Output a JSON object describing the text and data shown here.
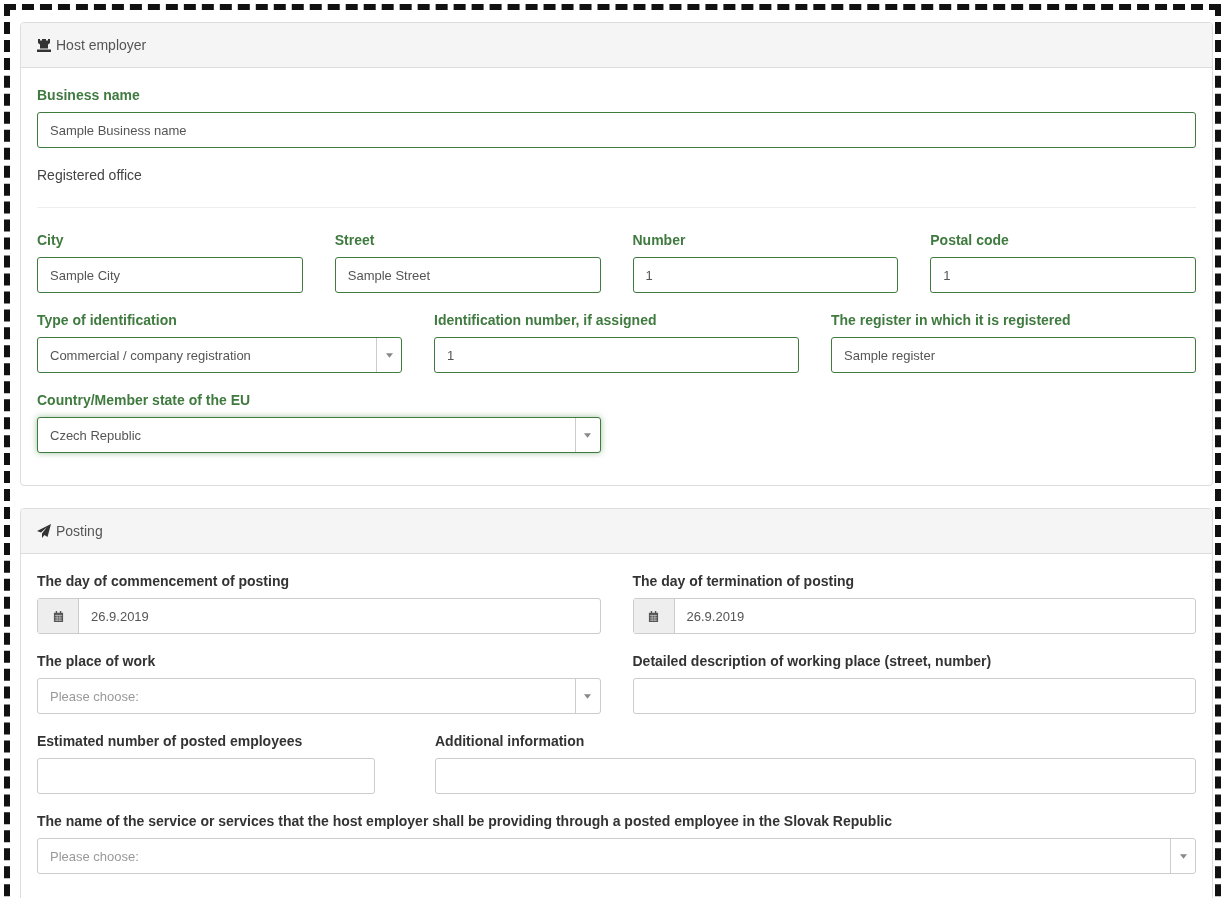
{
  "sections": [
    {
      "title": "Host employer",
      "rows": [
        {
          "kind": "fields",
          "fields": [
            {
              "label": "Business name",
              "kind": "text",
              "value": "Sample Business name",
              "validated": true,
              "focused": false
            }
          ]
        },
        {
          "kind": "heading",
          "text": "Registered office"
        },
        {
          "kind": "fields",
          "fields": [
            {
              "label": "City",
              "kind": "text",
              "value": "Sample City",
              "validated": true,
              "focused": false
            },
            {
              "label": "Street",
              "kind": "text",
              "value": "Sample Street",
              "validated": true,
              "focused": false
            },
            {
              "label": "Number",
              "kind": "text",
              "value": "1",
              "validated": true,
              "focused": false
            },
            {
              "label": "Postal code",
              "kind": "text",
              "value": "1",
              "validated": true,
              "focused": false
            }
          ]
        },
        {
          "kind": "fields",
          "fields": [
            {
              "label": "Type of identification",
              "kind": "select",
              "value": "Commercial / company registration",
              "validated": true,
              "focused": false
            },
            {
              "label": "Identification number, if assigned",
              "kind": "text",
              "value": "1",
              "validated": true,
              "focused": false
            },
            {
              "label": "The register in which it is registered",
              "kind": "text",
              "value": "Sample register",
              "validated": true,
              "focused": false
            }
          ]
        },
        {
          "kind": "fields",
          "fields": [
            {
              "label": "Country/Member state of the EU",
              "kind": "select",
              "value": "Czech Republic",
              "validated": true,
              "focused": true
            }
          ]
        }
      ]
    },
    {
      "title": "Posting",
      "rows": [
        {
          "kind": "fields",
          "fields": [
            {
              "label": "The day of commencement of posting",
              "kind": "date",
              "value": "26.9.2019",
              "validated": false,
              "focused": false
            },
            {
              "label": "The day of termination of posting",
              "kind": "date",
              "value": "26.9.2019",
              "validated": false,
              "focused": false
            }
          ]
        },
        {
          "kind": "fields",
          "fields": [
            {
              "label": "The place of work",
              "kind": "select",
              "placeholder": "Please choose:",
              "validated": false,
              "focused": false
            },
            {
              "label": "Detailed description of working place (street, number)",
              "kind": "text",
              "validated": false,
              "focused": false
            }
          ]
        },
        {
          "kind": "fields",
          "fields": [
            {
              "label": "Estimated number of posted employees",
              "kind": "text",
              "validated": false,
              "focused": false
            },
            {
              "label": "Additional information",
              "kind": "text",
              "validated": false,
              "focused": false
            }
          ]
        },
        {
          "kind": "fields",
          "fields": [
            {
              "label": "The name of the service or services that the host employer shall be providing through a posted employee in the Slovak Republic",
              "kind": "select",
              "placeholder": "Please choose:",
              "validated": false,
              "focused": false
            }
          ]
        }
      ]
    }
  ]
}
